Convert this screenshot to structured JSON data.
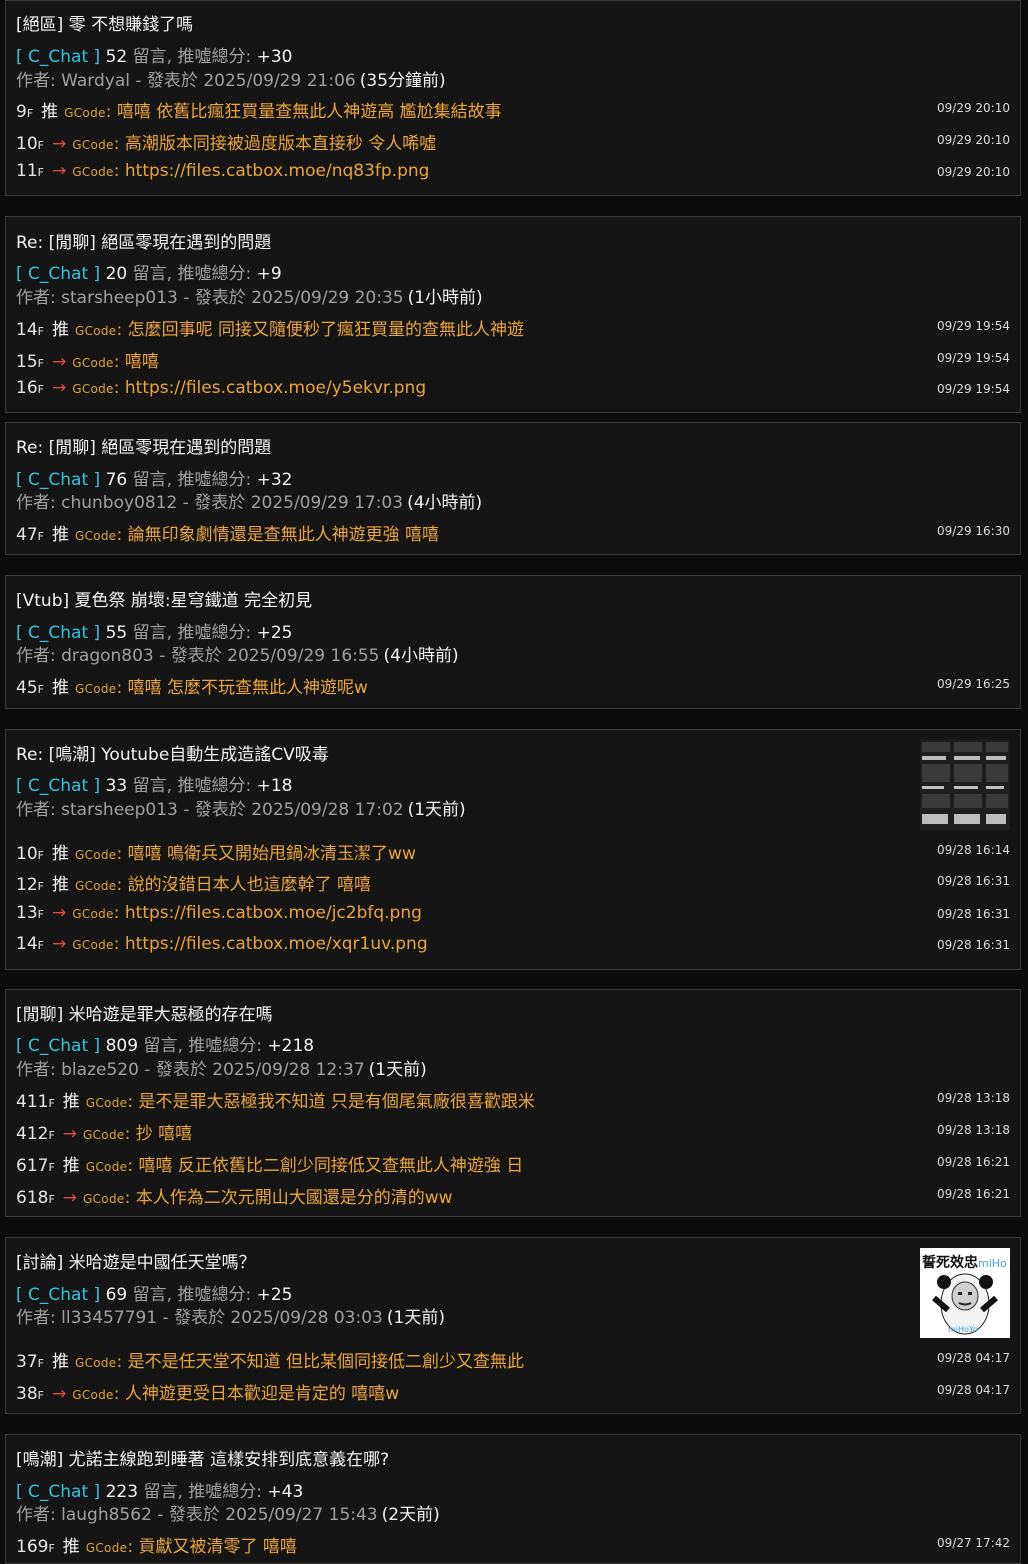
{
  "ui": {
    "comments_label": "留言,",
    "score_label": "推噓總分:",
    "author_label": "作者:",
    "posted_label": "- 發表於",
    "uid_label": "GCode",
    "floor_suffix": "F",
    "push_tag": "推",
    "arrow_tag": "→"
  },
  "colors": {
    "board": "#33c5dd",
    "comment": "#eaa53c",
    "arrow": "#e0483e",
    "card_bg": "#151515",
    "border": "#3a3a3a"
  },
  "posts": [
    {
      "title": "[絕區] 零 不想賺錢了嗎",
      "board": "C_Chat",
      "comments": "52",
      "score": "+30",
      "author": "Wardyal",
      "datetime": "2025/09/29 21:06",
      "relative": "(35分鐘前)",
      "thumbnail": null,
      "replies": [
        {
          "floor": "9",
          "type": "push",
          "text": "嘻嘻 依舊比瘋狂買量查無此人神遊高 尷尬集結故事",
          "time": "09/29 20:10"
        },
        {
          "floor": "10",
          "type": "arrow",
          "text": "高潮版本同接被過度版本直接秒 令人唏噓",
          "time": "09/29 20:10"
        },
        {
          "floor": "11",
          "type": "arrow",
          "text": "https://files.catbox.moe/nq83fp.png",
          "time": "09/29 20:10"
        }
      ]
    },
    {
      "title": "Re: [閒聊] 絕區零現在遇到的問題",
      "board": "C_Chat",
      "comments": "20",
      "score": "+9",
      "author": "starsheep013",
      "datetime": "2025/09/29 20:35",
      "relative": "(1小時前)",
      "thumbnail": null,
      "replies": [
        {
          "floor": "14",
          "type": "push",
          "text": "怎麼回事呢 同接又隨便秒了瘋狂買量的查無此人神遊",
          "time": "09/29 19:54"
        },
        {
          "floor": "15",
          "type": "arrow",
          "text": "嘻嘻",
          "time": "09/29 19:54"
        },
        {
          "floor": "16",
          "type": "arrow",
          "text": "https://files.catbox.moe/y5ekvr.png",
          "time": "09/29 19:54"
        }
      ]
    },
    {
      "title": "Re: [閒聊] 絕區零現在遇到的問題",
      "board": "C_Chat",
      "comments": "76",
      "score": "+32",
      "author": "chunboy0812",
      "datetime": "2025/09/29 17:03",
      "relative": "(4小時前)",
      "thumbnail": null,
      "replies": [
        {
          "floor": "47",
          "type": "push",
          "text": "論無印象劇情還是查無此人神遊更強 嘻嘻",
          "time": "09/29 16:30"
        }
      ]
    },
    {
      "title": "[Vtub] 夏色祭 崩壞:星穹鐵道 完全初見",
      "board": "C_Chat",
      "comments": "55",
      "score": "+25",
      "author": "dragon803",
      "datetime": "2025/09/29 16:55",
      "relative": "(4小時前)",
      "thumbnail": null,
      "replies": [
        {
          "floor": "45",
          "type": "push",
          "text": "嘻嘻 怎麼不玩查無此人神遊呢w",
          "time": "09/29 16:25"
        }
      ]
    },
    {
      "title": "Re: [鳴潮] Youtube自動生成造謠CV吸毒",
      "board": "C_Chat",
      "comments": "33",
      "score": "+18",
      "author": "starsheep013",
      "datetime": "2025/09/28 17:02",
      "relative": "(1天前)",
      "thumbnail": "screenshot",
      "replies": [
        {
          "floor": "10",
          "type": "push",
          "text": "嘻嘻 鳴衛兵又開始甩鍋冰清玉潔了ww",
          "time": "09/28 16:14"
        },
        {
          "floor": "12",
          "type": "push",
          "text": "說的沒錯日本人也這麼幹了 嘻嘻",
          "time": "09/28 16:31"
        },
        {
          "floor": "13",
          "type": "arrow",
          "text": "https://files.catbox.moe/jc2bfq.png",
          "time": "09/28 16:31"
        },
        {
          "floor": "14",
          "type": "arrow",
          "text": "https://files.catbox.moe/xqr1uv.png",
          "time": "09/28 16:31"
        }
      ]
    },
    {
      "title": "[閒聊] 米哈遊是罪大惡極的存在嗎",
      "board": "C_Chat",
      "comments": "809",
      "score": "+218",
      "author": "blaze520",
      "datetime": "2025/09/28 12:37",
      "relative": "(1天前)",
      "thumbnail": null,
      "replies": [
        {
          "floor": "411",
          "type": "push",
          "text": "是不是罪大惡極我不知道 只是有個尾氣廠很喜歡跟米",
          "time": "09/28 13:18"
        },
        {
          "floor": "412",
          "type": "arrow",
          "text": "抄 嘻嘻",
          "time": "09/28 13:18"
        },
        {
          "floor": "617",
          "type": "push",
          "text": "嘻嘻 反正依舊比二創少同接低又查無此人神遊強 日",
          "time": "09/28 16:21"
        },
        {
          "floor": "618",
          "type": "arrow",
          "text": "本人作為二次元開山大國還是分的清的ww",
          "time": "09/28 16:21"
        }
      ]
    },
    {
      "title": "[討論] 米哈遊是中國任天堂嗎？",
      "board": "C_Chat",
      "comments": "69",
      "score": "+25",
      "author": "ll33457791",
      "datetime": "2025/09/28 03:03",
      "relative": "(1天前)",
      "thumbnail": "meme",
      "meme_text": "誓死效忠",
      "meme_brand": "miHo",
      "meme_footer": "miHoYo",
      "replies": [
        {
          "floor": "37",
          "type": "push",
          "text": "是不是任天堂不知道 但比某個同接低二創少又查無此",
          "time": "09/28 04:17"
        },
        {
          "floor": "38",
          "type": "arrow",
          "text": "人神遊更受日本歡迎是肯定的 嘻嘻w",
          "time": "09/28 04:17"
        }
      ]
    },
    {
      "title": "[鳴潮] 尤諾主線跑到睡著 這樣安排到底意義在哪?",
      "board": "C_Chat",
      "comments": "223",
      "score": "+43",
      "author": "laugh8562",
      "datetime": "2025/09/27 15:43",
      "relative": "(2天前)",
      "thumbnail": null,
      "replies": [
        {
          "floor": "169",
          "type": "push",
          "text": "貢獻又被清零了 嘻嘻",
          "time": "09/27 17:42"
        }
      ]
    }
  ]
}
